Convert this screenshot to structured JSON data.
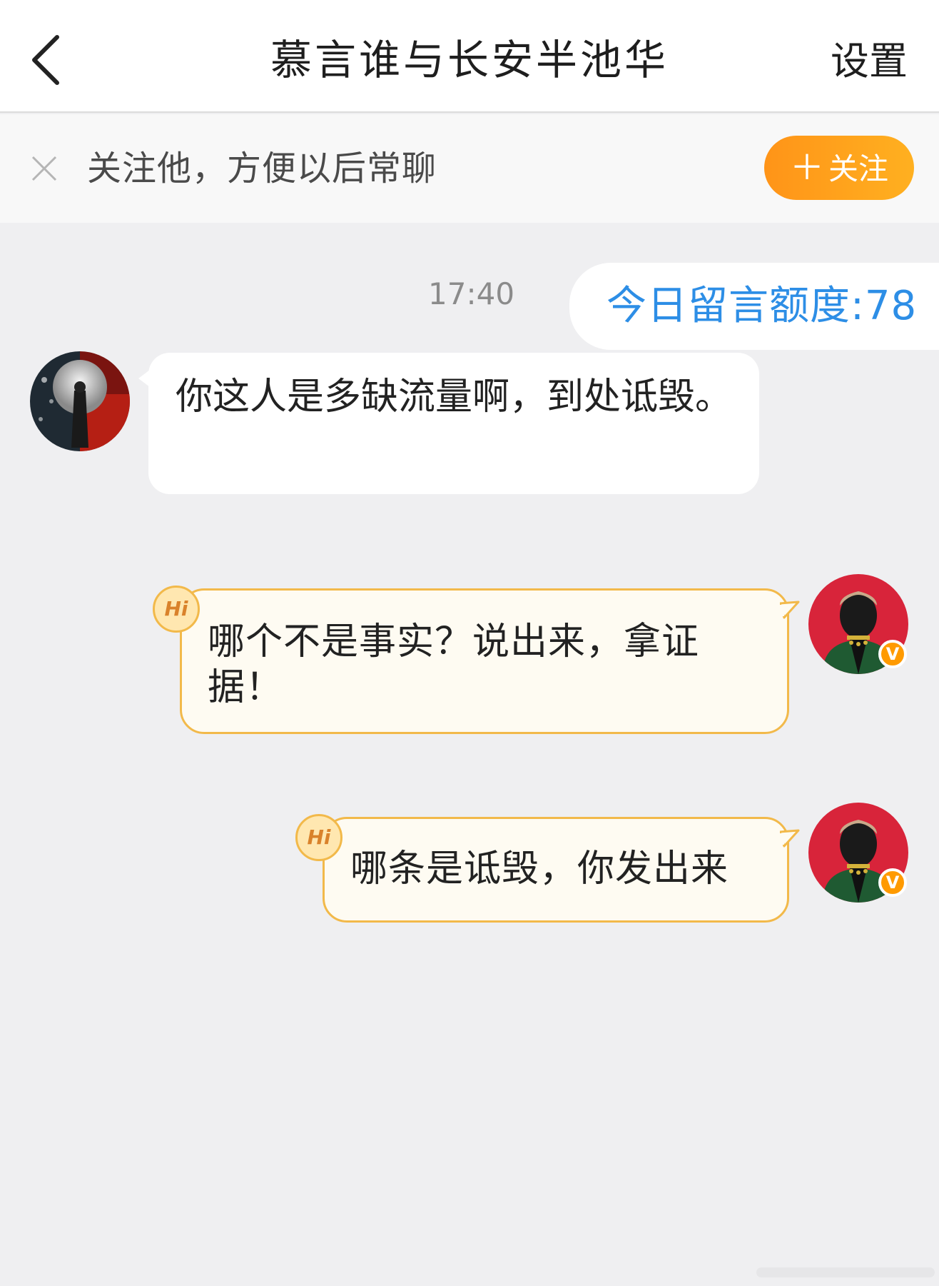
{
  "header": {
    "title": "慕言谁与长安半池华",
    "settings_label": "设置"
  },
  "follow_bar": {
    "text": "关注他，方便以后常聊",
    "button_label": "关注",
    "button_plus": "＋"
  },
  "chat": {
    "time": "17:40",
    "quota": "今日留言额度:78",
    "messages": [
      {
        "side": "incoming",
        "text": "你这人是多缺流量啊，到处诋毁。"
      },
      {
        "side": "outgoing",
        "text": "哪个不是事实？说出来，拿证据！",
        "badge": "Hi"
      },
      {
        "side": "outgoing",
        "text": "哪条是诋毁，你发出来",
        "badge": "Hi"
      }
    ],
    "vip_mark": "V"
  },
  "colors": {
    "accent_orange": "#ff9418",
    "quota_blue": "#2d8ee6",
    "outgoing_border": "#f2b94a",
    "outgoing_bg": "#fefbf2"
  }
}
